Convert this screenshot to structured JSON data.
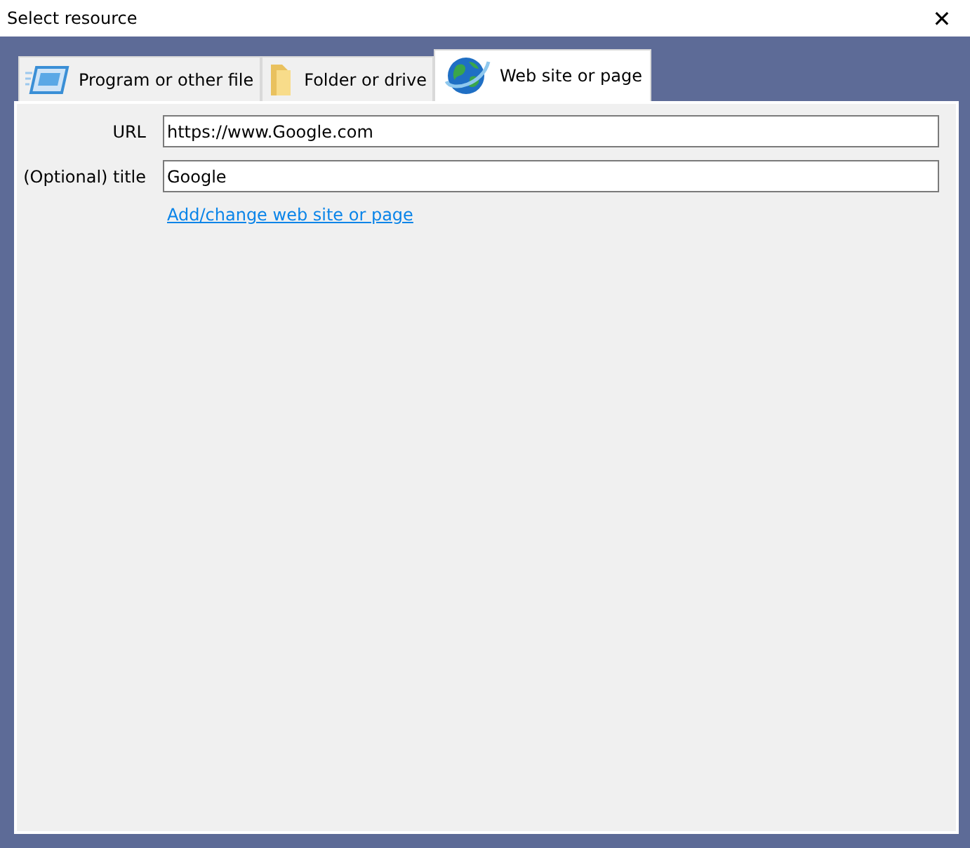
{
  "window": {
    "title": "Select resource",
    "close": "✕"
  },
  "tabs": [
    {
      "label": "Program or other file",
      "kind": "program",
      "selected": false
    },
    {
      "label": "Folder or drive",
      "kind": "folder",
      "selected": false
    },
    {
      "label": "Web site or page",
      "kind": "web",
      "selected": true
    }
  ],
  "form": {
    "fields": [
      {
        "label": "URL",
        "value": "https://www.Google.com"
      },
      {
        "label": "(Optional) title",
        "value": "Google"
      }
    ],
    "link": "Add/change web site or page"
  }
}
